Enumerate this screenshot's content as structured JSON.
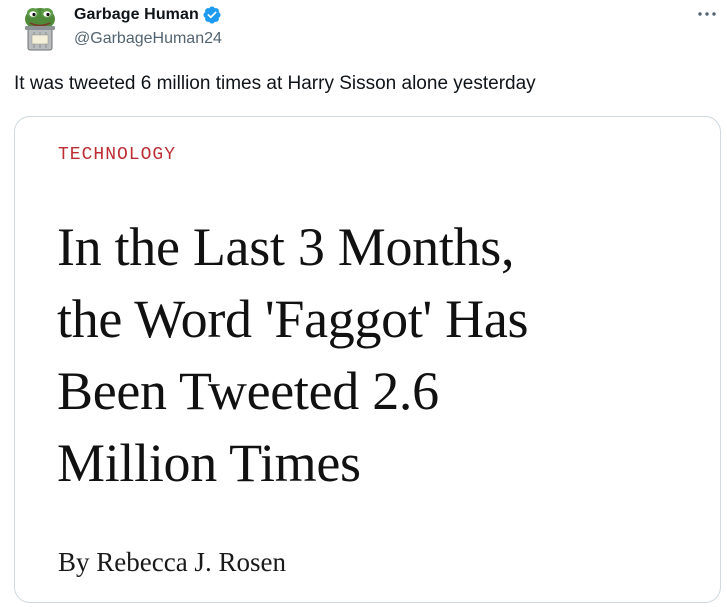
{
  "tweet": {
    "author": {
      "display_name": "Garbage Human",
      "handle": "@GarbageHuman24",
      "verified": true,
      "avatar_icon": "frog-in-trash-can-avatar"
    },
    "more_icon": "more-options-icon",
    "text": "It was tweeted 6 million times at Harry Sisson alone yesterday"
  },
  "card": {
    "kicker": "TECHNOLOGY",
    "headline_lines": [
      "In the Last 3 Months,",
      "the Word 'Faggot' Has",
      "Been Tweeted 2.6",
      "Million Times"
    ],
    "byline": "By Rebecca J. Rosen"
  },
  "colors": {
    "verified_badge": "#1d9bf0",
    "kicker": "#bc2e34",
    "handle": "#536471",
    "card_border": "#cfd9de"
  }
}
